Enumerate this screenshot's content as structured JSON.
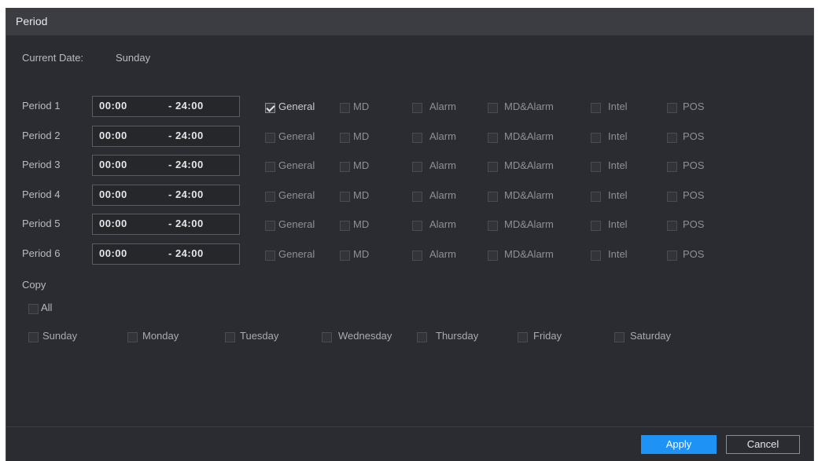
{
  "window": {
    "title": "Period"
  },
  "current_date": {
    "label": "Current Date:",
    "value": "Sunday"
  },
  "periods": [
    {
      "label": "Period 1",
      "start": "00:00",
      "end": "- 24:00",
      "checked": [
        "General"
      ]
    },
    {
      "label": "Period 2",
      "start": "00:00",
      "end": "- 24:00",
      "checked": []
    },
    {
      "label": "Period 3",
      "start": "00:00",
      "end": "- 24:00",
      "checked": []
    },
    {
      "label": "Period 4",
      "start": "00:00",
      "end": "- 24:00",
      "checked": []
    },
    {
      "label": "Period 5",
      "start": "00:00",
      "end": "- 24:00",
      "checked": []
    },
    {
      "label": "Period 6",
      "start": "00:00",
      "end": "- 24:00",
      "checked": []
    }
  ],
  "event_types": [
    "General",
    "MD",
    "Alarm",
    "MD&Alarm",
    "Intel",
    "POS"
  ],
  "copy": {
    "label": "Copy",
    "all_label": "All",
    "days": [
      "Sunday",
      "Monday",
      "Tuesday",
      "Wednesday",
      "Thursday",
      "Friday",
      "Saturday"
    ]
  },
  "buttons": {
    "apply": "Apply",
    "cancel": "Cancel"
  },
  "colors": {
    "accent": "#1f93f5",
    "panel": "#2b2c31",
    "titlebar": "#3c3d43"
  }
}
